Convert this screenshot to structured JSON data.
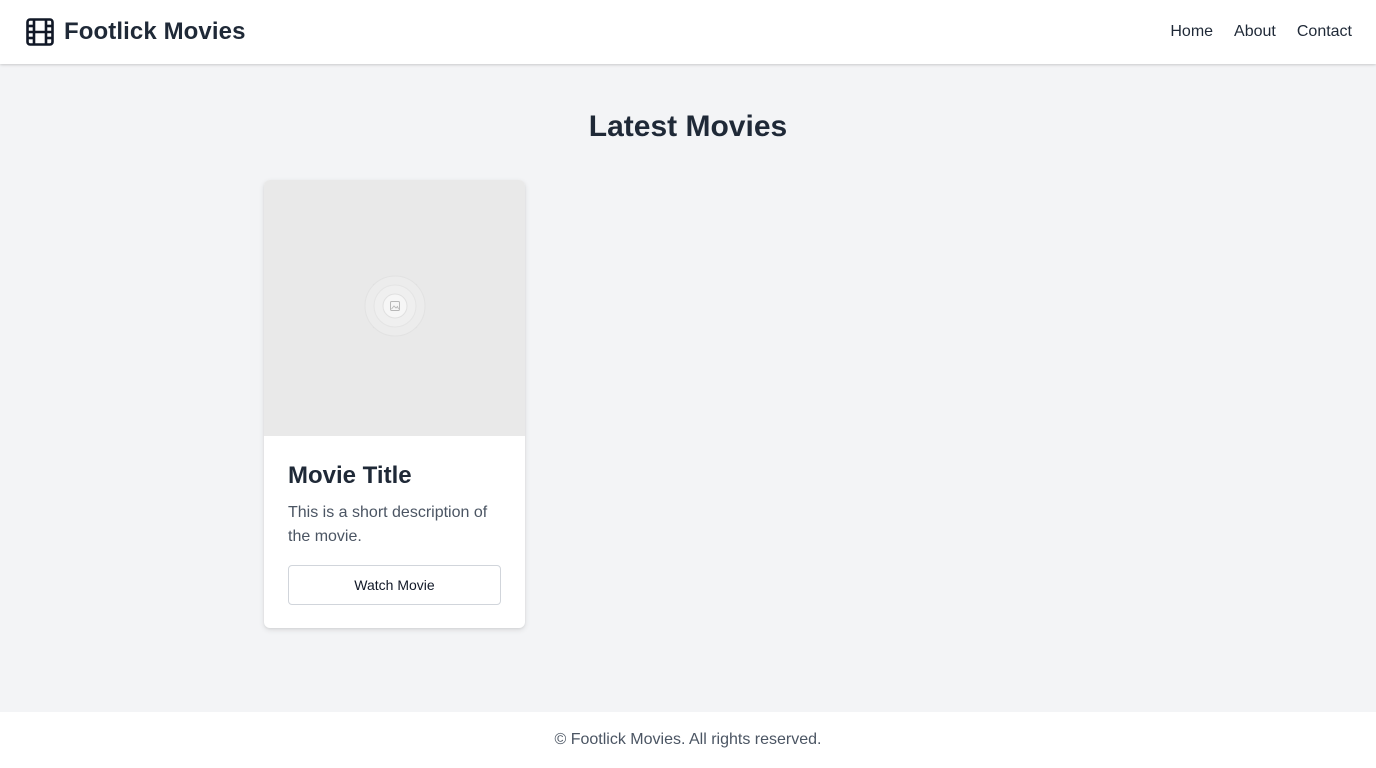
{
  "header": {
    "brand_icon": "film-icon",
    "brand_name": "Footlick Movies",
    "nav": [
      "Home",
      "About",
      "Contact"
    ]
  },
  "main": {
    "title": "Latest Movies",
    "movies": [
      {
        "thumbnail_icon": "image-placeholder-icon",
        "title": "Movie Title",
        "description": "This is a short description of the movie.",
        "button_label": "Watch Movie"
      }
    ]
  },
  "footer": {
    "text": "© Footlick Movies. All rights reserved."
  },
  "colors": {
    "background": "#f3f4f6",
    "surface": "#ffffff",
    "text_primary": "#1f2937",
    "text_secondary": "#4b5563",
    "thumbnail_bg": "#e9e9e9",
    "button_border": "#d1d5db"
  }
}
